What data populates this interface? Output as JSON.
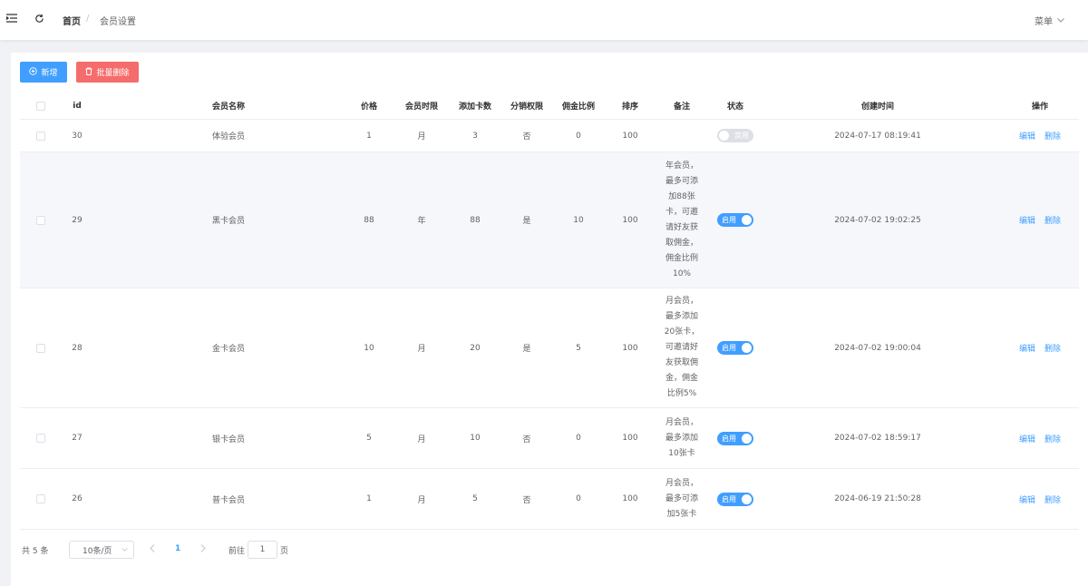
{
  "topbar": {
    "hamburger_icon": "hamburger-fold-icon",
    "refresh_icon": "refresh-icon",
    "breadcrumb_home": "首页",
    "breadcrumb_sep": "/",
    "breadcrumb_current": "会员设置",
    "menu_label": "菜单"
  },
  "toolbar": {
    "add_label": "新增",
    "batch_delete_label": "批量删除"
  },
  "table": {
    "headers": {
      "id": "id",
      "name": "会员名称",
      "price": "价格",
      "period": "会员时限",
      "cards": "添加卡数",
      "distribution": "分销权限",
      "commission": "佣金比例",
      "sort": "排序",
      "remark": "备注",
      "status": "状态",
      "created": "创建时间",
      "actions": "操作"
    },
    "rows": [
      {
        "id": "30",
        "name": "体验会员",
        "price": "1",
        "period": "月",
        "cards": "3",
        "distribution": "否",
        "commission": "0",
        "sort": "100",
        "remark": "",
        "status_on": false,
        "status_label": "禁用",
        "created": "2024-07-17 08:19:41",
        "edit": "编辑",
        "delete": "删除"
      },
      {
        "id": "29",
        "name": "黑卡会员",
        "price": "88",
        "period": "年",
        "cards": "88",
        "distribution": "是",
        "commission": "10",
        "sort": "100",
        "remark": "年会员，\n最多可添\n加88张\n卡，可邀\n请好友获\n取佣金，\n佣金比例\n10%",
        "status_on": true,
        "status_label": "启用",
        "created": "2024-07-02 19:02:25",
        "edit": "编辑",
        "delete": "删除"
      },
      {
        "id": "28",
        "name": "金卡会员",
        "price": "10",
        "period": "月",
        "cards": "20",
        "distribution": "是",
        "commission": "5",
        "sort": "100",
        "remark": "月会员，\n最多添加\n20张卡，\n可邀请好\n友获取佣\n金，佣金\n比例5%",
        "status_on": true,
        "status_label": "启用",
        "created": "2024-07-02 19:00:04",
        "edit": "编辑",
        "delete": "删除"
      },
      {
        "id": "27",
        "name": "银卡会员",
        "price": "5",
        "period": "月",
        "cards": "10",
        "distribution": "否",
        "commission": "0",
        "sort": "100",
        "remark": "月会员，\n最多添加\n10张卡",
        "status_on": true,
        "status_label": "启用",
        "created": "2024-07-02 18:59:17",
        "edit": "编辑",
        "delete": "删除"
      },
      {
        "id": "26",
        "name": "普卡会员",
        "price": "1",
        "period": "月",
        "cards": "5",
        "distribution": "否",
        "commission": "0",
        "sort": "100",
        "remark": "月会员，\n最多可添\n加5张卡",
        "status_on": true,
        "status_label": "启用",
        "created": "2024-06-19 21:50:28",
        "edit": "编辑",
        "delete": "删除"
      }
    ]
  },
  "pagination": {
    "total_label": "共 5 条",
    "page_size": "10条/页",
    "current_page": "1",
    "goto_prefix": "前往",
    "goto_value": "1",
    "goto_suffix": "页"
  },
  "colors": {
    "primary": "#409eff",
    "danger": "#f56c6c",
    "switch_off": "#dcdfe6"
  }
}
